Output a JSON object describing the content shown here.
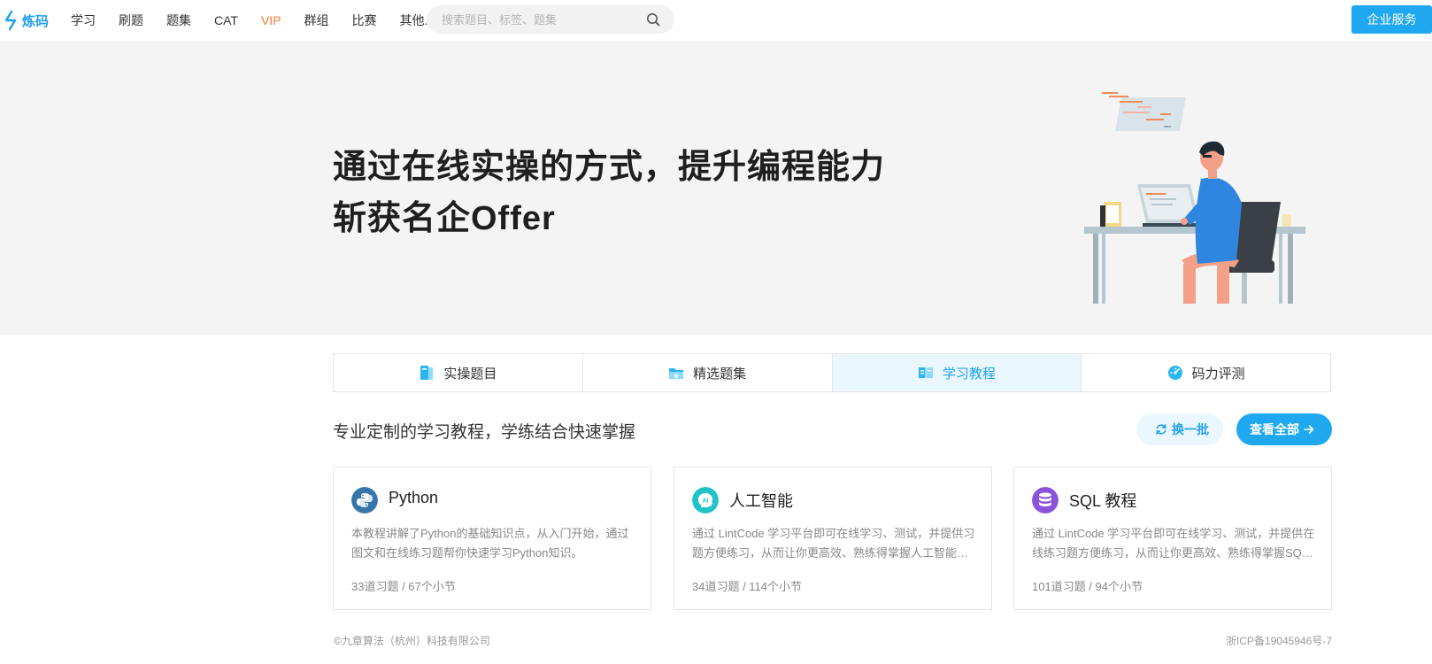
{
  "nav": {
    "logo_text": "炼码",
    "items": [
      "学习",
      "刷题",
      "题集",
      "CAT",
      "VIP",
      "群组",
      "比赛",
      "其他..."
    ],
    "search_placeholder": "搜索题目、标签、题集",
    "enterprise_label": "企业服务"
  },
  "hero": {
    "line1": "通过在线实操的方式，提升编程能力",
    "line2": "斩获名企Offer"
  },
  "tabs": [
    {
      "label": "实操题目"
    },
    {
      "label": "精选题集"
    },
    {
      "label": "学习教程"
    },
    {
      "label": "码力评测"
    }
  ],
  "section": {
    "title": "专业定制的学习教程，学练结合快速掌握",
    "refresh_label": "换一批",
    "viewall_label": "查看全部"
  },
  "cards": [
    {
      "title": "Python",
      "desc": "本教程讲解了Python的基础知识点，从入门开始，通过图文和在线练习题帮你快速学习Python知识。",
      "meta": "33道习题 / 67个小节"
    },
    {
      "title": "人工智能",
      "desc": "通过 LintCode 学习平台即可在线学习、测试，并提供习题方便练习，从而让你更高效、熟练得掌握人工智能知识。",
      "meta": "34道习题 / 114个小节"
    },
    {
      "title": "SQL 教程",
      "desc": "通过 LintCode 学习平台即可在线学习、测试，并提供在线练习题方便练习，从而让你更高效、熟练得掌握SQL知识。",
      "meta": "101道习题 / 94个小节"
    }
  ],
  "footer": {
    "copyright": "©九章算法（杭州）科技有限公司",
    "icp": "浙ICP备19045946号-7"
  },
  "colors": {
    "accent": "#1fa8f0",
    "vip": "#ff7a2e",
    "hero_bg": "#f4f4f4"
  }
}
